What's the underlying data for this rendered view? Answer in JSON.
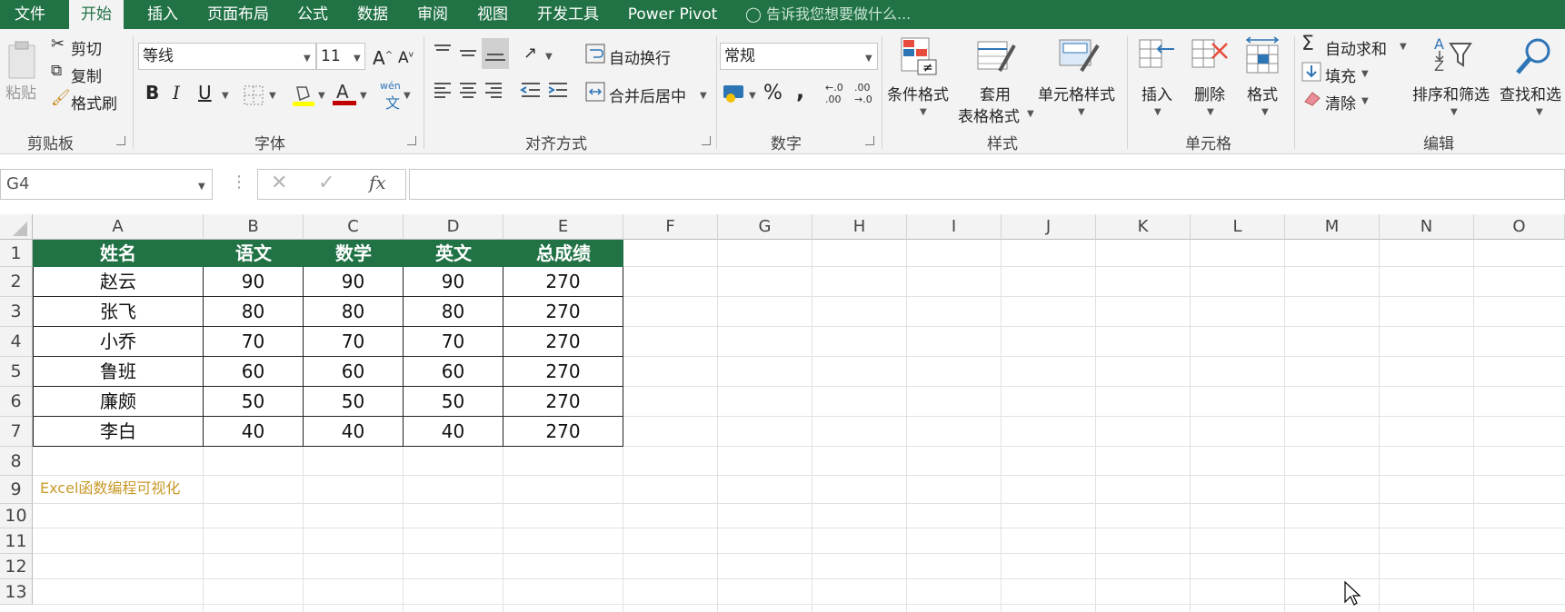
{
  "tabs": [
    "文件",
    "开始",
    "插入",
    "页面布局",
    "公式",
    "数据",
    "审阅",
    "视图",
    "开发工具",
    "Power Pivot"
  ],
  "tell_me": "告诉我您想要做什么...",
  "ribbon": {
    "clipboard": {
      "paste": "粘贴",
      "cut": "剪切",
      "copy": "复制",
      "format_painter": "格式刷",
      "group": "剪贴板"
    },
    "font": {
      "name": "等线",
      "size": "11",
      "group": "字体",
      "bold": "B",
      "italic": "I",
      "underline": "U",
      "phonetic": "wén"
    },
    "align": {
      "wrap": "自动换行",
      "merge": "合并后居中",
      "group": "对齐方式"
    },
    "number": {
      "format": "常规",
      "group": "数字",
      "percent": "%",
      "comma": ","
    },
    "styles": {
      "conditional": "条件格式",
      "table_fmt_1": "套用",
      "table_fmt_2": "表格格式",
      "cell_styles": "单元格样式",
      "group": "样式"
    },
    "cells": {
      "insert": "插入",
      "delete": "删除",
      "format": "格式",
      "group": "单元格"
    },
    "editing": {
      "autosum": "自动求和",
      "fill": "填充",
      "clear": "清除",
      "sort": "排序和筛选",
      "find": "查找和选",
      "group": "编辑"
    }
  },
  "formula_bar": {
    "name_box": "G4",
    "fx": "fx",
    "value": ""
  },
  "columns": [
    "A",
    "B",
    "C",
    "D",
    "E",
    "F",
    "G",
    "H",
    "I",
    "J",
    "K",
    "L",
    "M",
    "N",
    "O"
  ],
  "rows": [
    "1",
    "2",
    "3",
    "4",
    "5",
    "6",
    "7",
    "8",
    "9",
    "10",
    "11",
    "12",
    "13"
  ],
  "table": {
    "headers": [
      "姓名",
      "语文",
      "数学",
      "英文",
      "总成绩"
    ],
    "header_bg": "#217346",
    "data": [
      [
        "赵云",
        "90",
        "90",
        "90",
        "270"
      ],
      [
        "张飞",
        "80",
        "80",
        "80",
        "270"
      ],
      [
        "小乔",
        "70",
        "70",
        "70",
        "270"
      ],
      [
        "鲁班",
        "60",
        "60",
        "60",
        "270"
      ],
      [
        "廉颇",
        "50",
        "50",
        "50",
        "270"
      ],
      [
        "李白",
        "40",
        "40",
        "40",
        "270"
      ]
    ]
  },
  "watermark": "Excel函数编程可视化",
  "watermark_color": "#c89a2a"
}
